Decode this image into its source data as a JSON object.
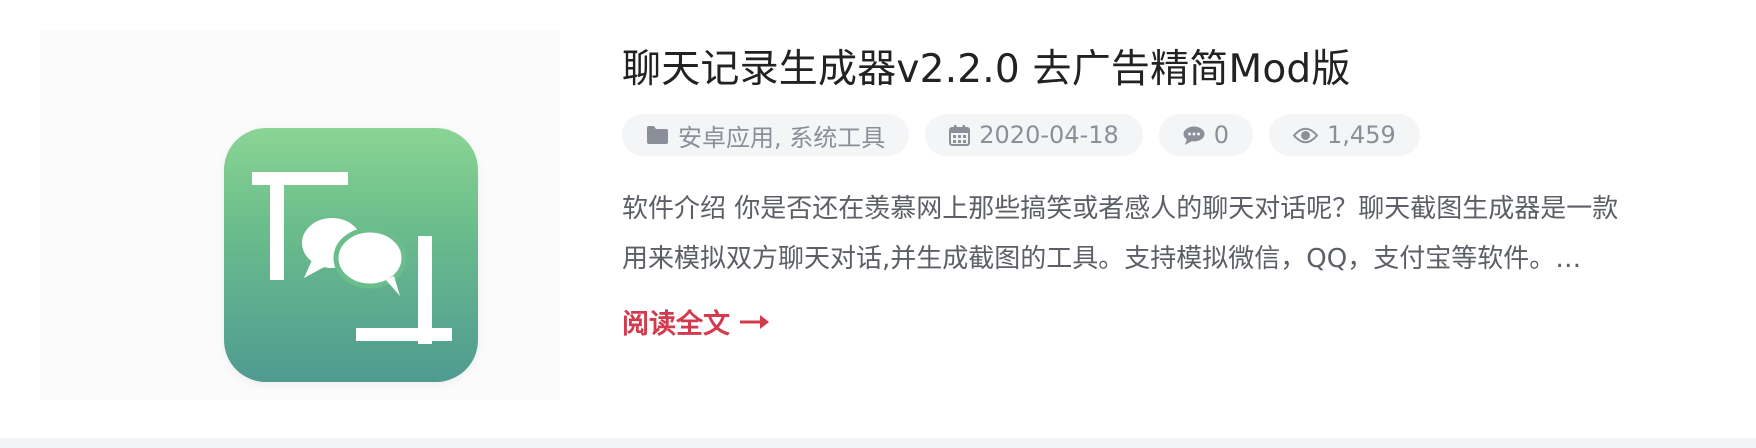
{
  "post": {
    "title": "聊天记录生成器v2.2.0 去广告精简Mod版",
    "categories": "安卓应用, 系统工具",
    "date": "2020-04-18",
    "comments": "0",
    "views": "1,459",
    "excerpt_line1": "软件介绍 你是否还在羡慕网上那些搞笑或者感人的聊天对话呢？聊天截图生成器是一款",
    "excerpt_line2": "用来模拟双方聊天对话,并生成截图的工具。支持模拟微信，QQ，支付宝等软件。…",
    "read_more": "阅读全文"
  },
  "icons": {
    "thumbnail": "chat-screenshot-app-icon",
    "categories": "folder-icon",
    "date": "calendar-icon",
    "comments": "comment-icon",
    "views": "eye-icon",
    "read_more": "arrow-right-icon"
  },
  "colors": {
    "accent": "#d23b4e",
    "meta_text": "#8a8f99",
    "pill_bg": "#f4f5f7",
    "icon_gradient_top": "#8ad594",
    "icon_gradient_bottom": "#4f9b91"
  }
}
